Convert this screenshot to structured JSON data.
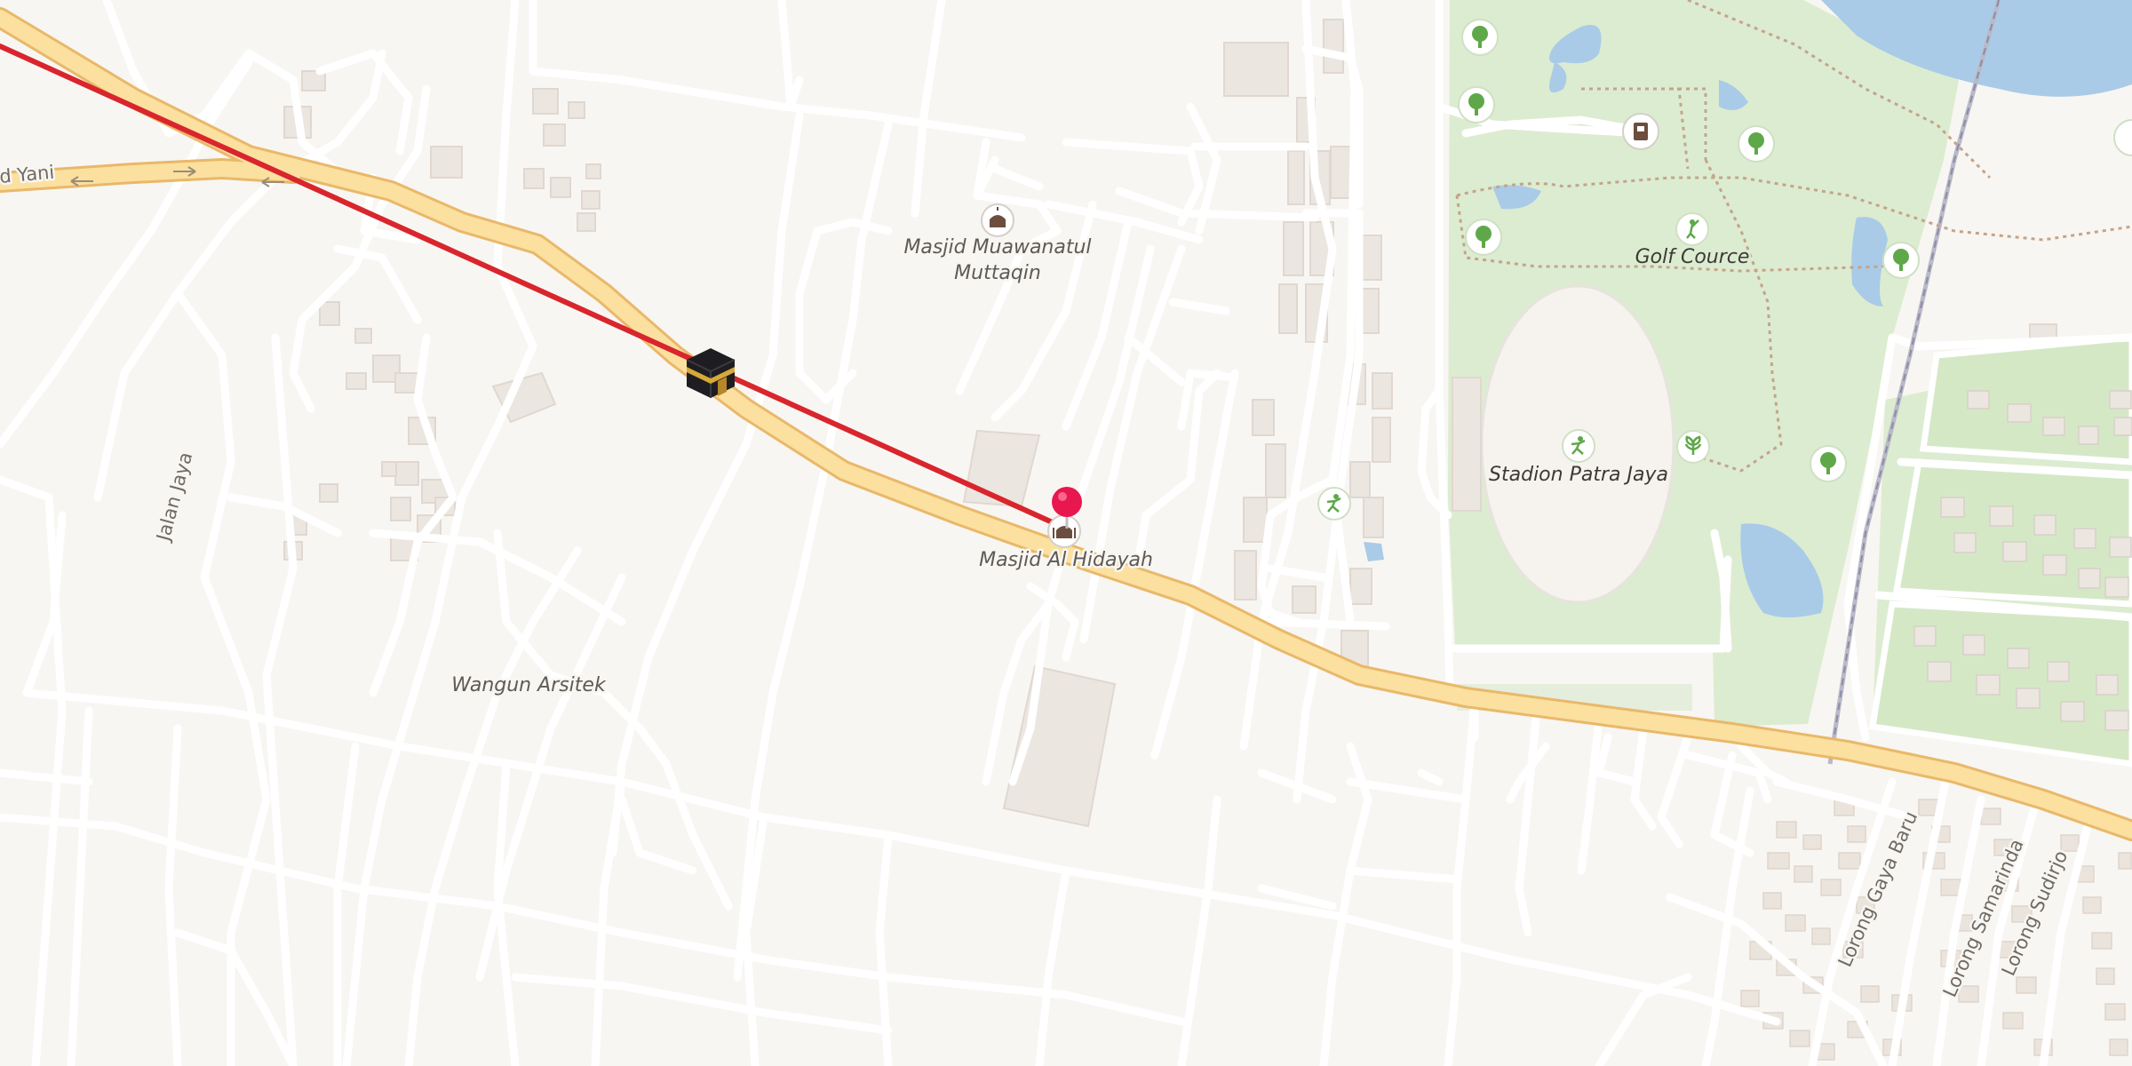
{
  "map": {
    "labels": {
      "road_main": "d Yani",
      "jalan_jaya": "Jalan Jaya",
      "mosque_1_line1": "Masjid Muawanatul",
      "mosque_1_line2": "Muttaqin",
      "mosque_2": "Masjid Al Hidayah",
      "wangun": "Wangun Arsitek",
      "golf": "Golf Cource",
      "stadium": "Stadion Patra Jaya",
      "lorong_gaya_baru": "Lorong Gaya Baru",
      "lorong_samarinda": "Lorong Samarinda",
      "lorong_sudirjo": "Lorong Sudirjo"
    },
    "markers": {
      "kaaba": "kaaba-icon",
      "location_pin": "location-pin-icon",
      "qibla_line": "qibla-direction-line"
    },
    "colors": {
      "background": "#f8f6f2",
      "park": "#dcecd0",
      "water": "#a9cbe8",
      "main_road": "#fbe0a0",
      "main_road_casing": "#e9b86a",
      "minor_road": "#ffffff",
      "building": "#ece6e0",
      "qibla_line": "#d9252d",
      "pin": "#e8174f",
      "tree_icon": "#5fa84a"
    }
  }
}
